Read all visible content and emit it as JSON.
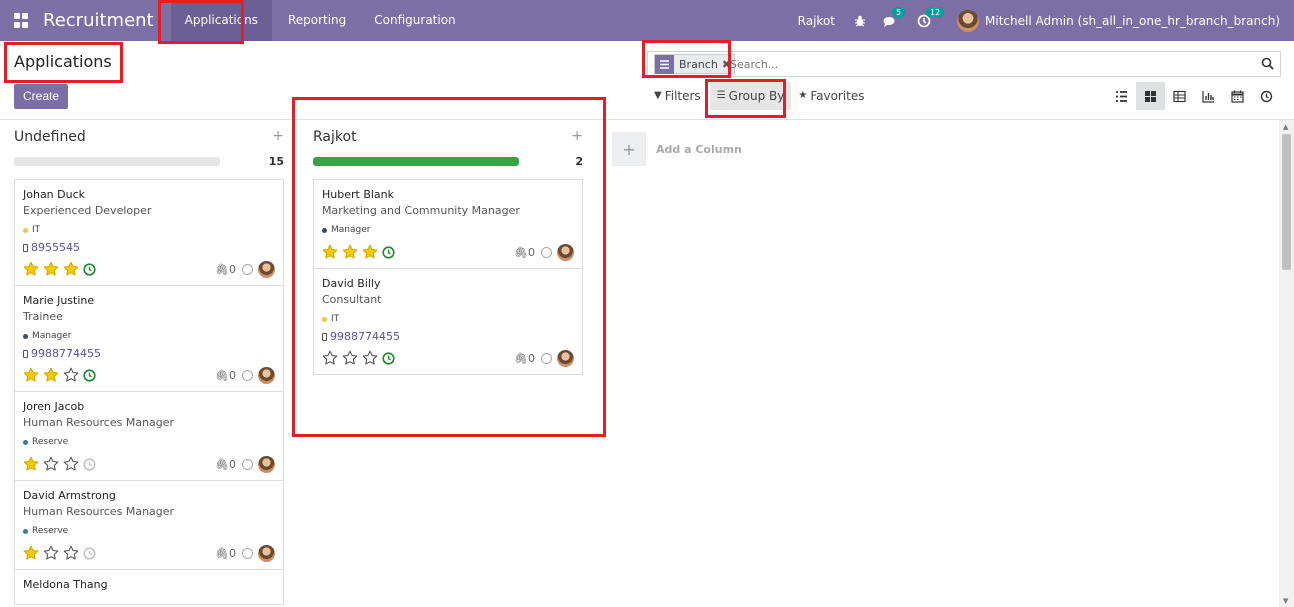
{
  "navbar": {
    "brand": "Recruitment",
    "menu": [
      {
        "label": "Applications",
        "active": true
      },
      {
        "label": "Reporting",
        "active": false
      },
      {
        "label": "Configuration",
        "active": false
      }
    ],
    "branch": "Rajkot",
    "messages_count": "5",
    "activities_count": "12",
    "user": "Mitchell Admin (sh_all_in_one_hr_branch_branch)"
  },
  "control_panel": {
    "title": "Applications",
    "create_label": "Create",
    "facet_label": "Branch",
    "facet_remove": "✖",
    "search_placeholder": "Search...",
    "filters_label": "Filters",
    "groupby_label": "Group By",
    "favorites_label": "Favorites",
    "views": [
      "list-icon",
      "kanban-icon",
      "pivot-icon",
      "graph-icon",
      "calendar-icon",
      "activity-icon"
    ],
    "active_view": "kanban-icon"
  },
  "columns": [
    {
      "title": "Undefined",
      "count": "15",
      "progress_fraction": 0,
      "cards": [
        {
          "name": "Johan Duck",
          "job": "Experienced Developer",
          "tag": "IT",
          "tag_color": "#f4c542",
          "phone": "8955545",
          "stars": 3,
          "clock": "green",
          "attachments": "0"
        },
        {
          "name": "Marie Justine",
          "job": "Trainee",
          "tag": "Manager",
          "tag_color": "#3d4a6b",
          "phone": "9988774455",
          "stars": 2,
          "clock": "green",
          "attachments": "0"
        },
        {
          "name": "Joren Jacob",
          "job": "Human Resources Manager",
          "tag": "Reserve",
          "tag_color": "#3f7a9a",
          "phone": "",
          "stars": 1,
          "clock": "grey",
          "attachments": "0"
        },
        {
          "name": "David Armstrong",
          "job": "Human Resources Manager",
          "tag": "Reserve",
          "tag_color": "#3f7a9a",
          "phone": "",
          "stars": 1,
          "clock": "grey",
          "attachments": "0"
        },
        {
          "name": "Meldona Thang",
          "job": "",
          "tag": "",
          "tag_color": "",
          "phone": "",
          "stars": 0,
          "clock": "",
          "attachments": ""
        }
      ]
    },
    {
      "title": "Rajkot",
      "count": "2",
      "progress_fraction": 1,
      "cards": [
        {
          "name": "Hubert Blank",
          "job": "Marketing and Community Manager",
          "tag": "Manager",
          "tag_color": "#3d4a6b",
          "phone": "",
          "stars": 3,
          "clock": "green",
          "attachments": "0"
        },
        {
          "name": "David Billy",
          "job": "Consultant",
          "tag": "IT",
          "tag_color": "#f4c542",
          "phone": "9988774455",
          "stars": 0,
          "clock": "green",
          "attachments": "0"
        }
      ]
    }
  ],
  "add_column_label": "Add a Column",
  "colors": {
    "navbar": "#7c6fa6",
    "star": "#f3cc00",
    "progress": "#3aa346",
    "highlight": "#e31e24"
  }
}
